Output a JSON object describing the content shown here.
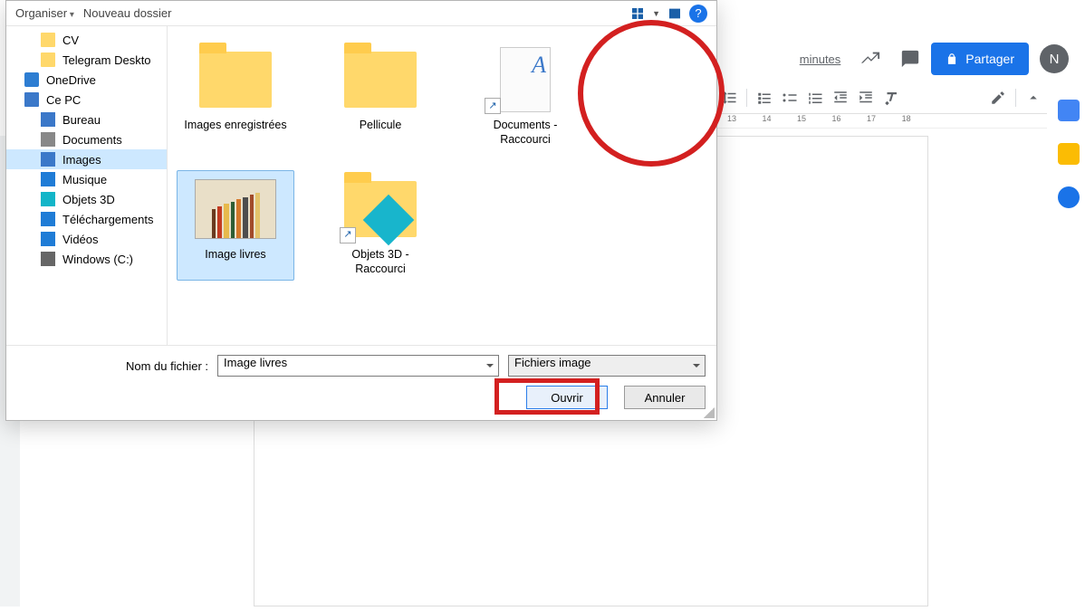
{
  "gdocs": {
    "last_edit": "minutes",
    "share_label": "Partager",
    "avatar_letter": "N",
    "ruler_marks": [
      "13",
      "14",
      "15",
      "16",
      "17",
      "18"
    ]
  },
  "dialog": {
    "toolbar": {
      "organiser": "Organiser",
      "new_folder": "Nouveau dossier"
    },
    "sidebar": [
      {
        "icon": "folder-y",
        "label": "CV",
        "lvl": 2
      },
      {
        "icon": "folder-y",
        "label": "Telegram Deskto",
        "lvl": 2
      },
      {
        "icon": "onedrive-i",
        "label": "OneDrive",
        "lvl": 1
      },
      {
        "icon": "pc-i",
        "label": "Ce PC",
        "lvl": 1
      },
      {
        "icon": "desk-i",
        "label": "Bureau",
        "lvl": 2
      },
      {
        "icon": "doc-i",
        "label": "Documents",
        "lvl": 2
      },
      {
        "icon": "img-i",
        "label": "Images",
        "lvl": 2,
        "selected": true
      },
      {
        "icon": "mus-i",
        "label": "Musique",
        "lvl": 2
      },
      {
        "icon": "obj-i",
        "label": "Objets 3D",
        "lvl": 2
      },
      {
        "icon": "dl-i",
        "label": "Téléchargements",
        "lvl": 2
      },
      {
        "icon": "vid-i",
        "label": "Vidéos",
        "lvl": 2
      },
      {
        "icon": "drive-i",
        "label": "Windows (C:)",
        "lvl": 2
      }
    ],
    "files": [
      {
        "kind": "folder",
        "label": "Images enregistrées"
      },
      {
        "kind": "folder",
        "label": "Pellicule"
      },
      {
        "kind": "doc-shortcut",
        "label": "Documents - Raccourci"
      },
      {
        "kind": "image",
        "label": "Image livres",
        "selected": true,
        "books": [
          "#6b3b1f",
          "#c23b22",
          "#e7b94c",
          "#2e5d34",
          "#d4782a",
          "#4d4d4d",
          "#a24b2a",
          "#e4c36b"
        ]
      },
      {
        "kind": "obj3d-shortcut",
        "label": "Objets 3D - Raccourci"
      }
    ],
    "filename_label": "Nom du fichier :",
    "filename_value": "Image livres",
    "filetype_value": "Fichiers image",
    "open_label": "Ouvrir",
    "cancel_label": "Annuler"
  }
}
